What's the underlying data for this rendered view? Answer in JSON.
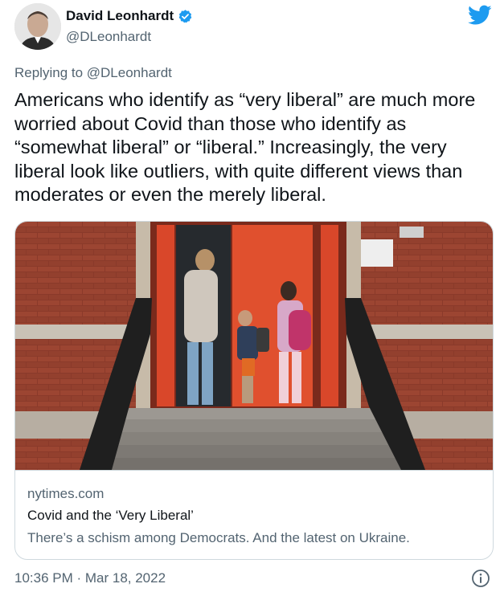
{
  "author": {
    "display_name": "David Leonhardt",
    "handle": "@DLeonhardt",
    "verified": true
  },
  "reply_context": "Replying to @DLeonhardt",
  "tweet_text": "Americans who identify as “very liberal” are much more worried about Covid than those who identify as “somewhat liberal” or “liberal.” Increasingly, the very liberal look like outliers, with quite different views than moderates or even the merely liberal.",
  "link_card": {
    "domain": "nytimes.com",
    "title": "Covid and the ‘Very Liberal’",
    "description": "There’s a schism among Democrats. And the latest on Ukraine."
  },
  "timestamp": "10:36 PM · Mar 18, 2022",
  "icons": {
    "brand": "twitter-bird-icon",
    "verified": "verified-badge-icon",
    "info": "info-icon"
  },
  "colors": {
    "brand_blue": "#1d9bf0",
    "text_primary": "#0f1419",
    "text_secondary": "#536471",
    "border": "#cfd9de"
  }
}
